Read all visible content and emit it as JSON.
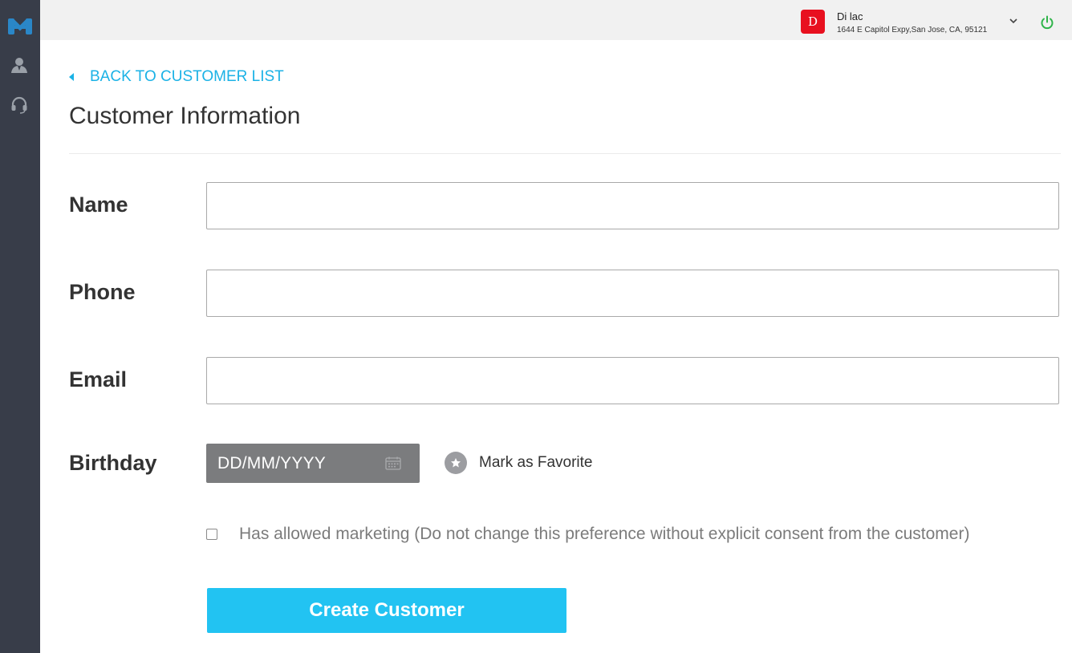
{
  "colors": {
    "accent": "#1bb2e6",
    "button": "#22c3f2",
    "sidebar": "#383d49",
    "store_badge": "#e8101f",
    "power": "#2fb44a"
  },
  "sidebar": {
    "logo_icon": "app-logo",
    "items": [
      {
        "icon": "customer-icon"
      },
      {
        "icon": "headset-icon"
      }
    ]
  },
  "topbar": {
    "store_initial": "D",
    "store_name": "Di lac",
    "store_address": "1644 E Capitol Expy,San Jose, CA, 95121",
    "dropdown_icon": "chevron-down-icon",
    "power_icon": "power-icon"
  },
  "main": {
    "back_label": "BACK TO CUSTOMER LIST",
    "title": "Customer Information",
    "fields": {
      "name_label": "Name",
      "name_value": "",
      "phone_label": "Phone",
      "phone_value": "",
      "email_label": "Email",
      "email_value": "",
      "birthday_label": "Birthday",
      "birthday_placeholder": "DD/MM/YYYY"
    },
    "favorite_label": "Mark as Favorite",
    "marketing_label": "Has allowed marketing (Do not change this preference without explicit consent from the customer)",
    "marketing_checked": false,
    "create_button": "Create Customer"
  }
}
